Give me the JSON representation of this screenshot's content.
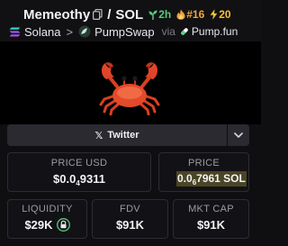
{
  "header": {
    "token_name": "Memeothy",
    "separator": "/",
    "quote_symbol": "SOL",
    "age": "2h",
    "rank": "#16",
    "boosts": "20"
  },
  "breadcrumb": {
    "chain": "Solana",
    "arrow": ">",
    "dex": "PumpSwap",
    "via": "via",
    "launchpad": "Pump.fun"
  },
  "socials": {
    "twitter_label": "Twitter"
  },
  "stats": {
    "price_usd_label": "PRICE USD",
    "price_usd_prefix": "$0.0",
    "price_usd_zeros": "4",
    "price_usd_digits": "9311",
    "price_sol_label": "PRICE",
    "price_sol_prefix": "0.0",
    "price_sol_zeros": "6",
    "price_sol_digits": "7961 SOL",
    "liquidity_label": "LIQUIDITY",
    "liquidity_value": "$29K",
    "fdv_label": "FDV",
    "fdv_value": "$91K",
    "mktcap_label": "MKT CAP",
    "mktcap_value": "$91K"
  },
  "colors": {
    "background": "#0f0f12",
    "age_green": "#56c97a",
    "rank_orange": "#f2a23a",
    "boost_yellow": "#f7c233",
    "highlight": "#4a4525"
  },
  "icons": [
    "copy-icon",
    "seedling-icon",
    "flame-icon",
    "lightning-icon",
    "solana-icon",
    "pumpswap-icon",
    "pill-icon",
    "crab-icon",
    "x-icon",
    "chevron-down-icon",
    "lock-icon"
  ]
}
